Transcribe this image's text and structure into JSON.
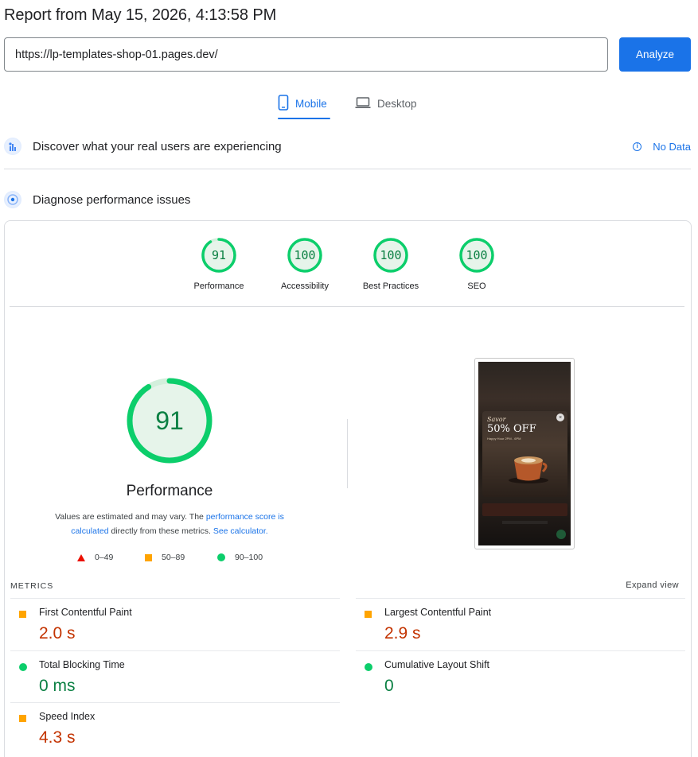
{
  "report": {
    "title": "Report from May 15, 2026, 4:13:58 PM"
  },
  "url_bar": {
    "value": "https://lp-templates-shop-01.pages.dev/",
    "analyze_label": "Analyze"
  },
  "tabs": [
    {
      "label": "Mobile",
      "active": true,
      "icon": "phone-icon"
    },
    {
      "label": "Desktop",
      "active": false,
      "icon": "laptop-icon"
    }
  ],
  "field_section": {
    "title": "Discover what your real users are experiencing",
    "status": "No Data"
  },
  "lab_section": {
    "title": "Diagnose performance issues"
  },
  "scores": [
    {
      "label": "Performance",
      "value": "91"
    },
    {
      "label": "Accessibility",
      "value": "100"
    },
    {
      "label": "Best Practices",
      "value": "100"
    },
    {
      "label": "SEO",
      "value": "100"
    }
  ],
  "main_score": {
    "value": "91",
    "label": "Performance",
    "disclaimer_pre": "Values are estimated and may vary. The ",
    "disclaimer_link1": "performance score is calculated",
    "disclaimer_mid": " directly from these metrics. ",
    "disclaimer_link2": "See calculator.",
    "legend": [
      {
        "range": "0–49",
        "shape": "triangle",
        "color": "#eb0f00"
      },
      {
        "range": "50–89",
        "shape": "square",
        "color": "#ffa400"
      },
      {
        "range": "90–100",
        "shape": "circle",
        "color": "#0cce6b"
      }
    ]
  },
  "screenshot": {
    "line1": "Savor",
    "line2": "50% OFF",
    "line3": "Happy Hour 2PM - 6PM"
  },
  "metrics": {
    "heading": "METRICS",
    "expand_label": "Expand view",
    "items": [
      {
        "label": "First Contentful Paint",
        "value": "2.0 s",
        "rating": "average"
      },
      {
        "label": "Largest Contentful Paint",
        "value": "2.9 s",
        "rating": "average"
      },
      {
        "label": "Total Blocking Time",
        "value": "0 ms",
        "rating": "good"
      },
      {
        "label": "Cumulative Layout Shift",
        "value": "0",
        "rating": "good"
      },
      {
        "label": "Speed Index",
        "value": "4.3 s",
        "rating": "average"
      }
    ]
  },
  "colors": {
    "accent": "#1a73e8",
    "pass": "#0cce6b",
    "pass_text": "#0b8043",
    "average": "#ffa400",
    "average_text": "#c33300",
    "fail": "#eb0f00"
  }
}
